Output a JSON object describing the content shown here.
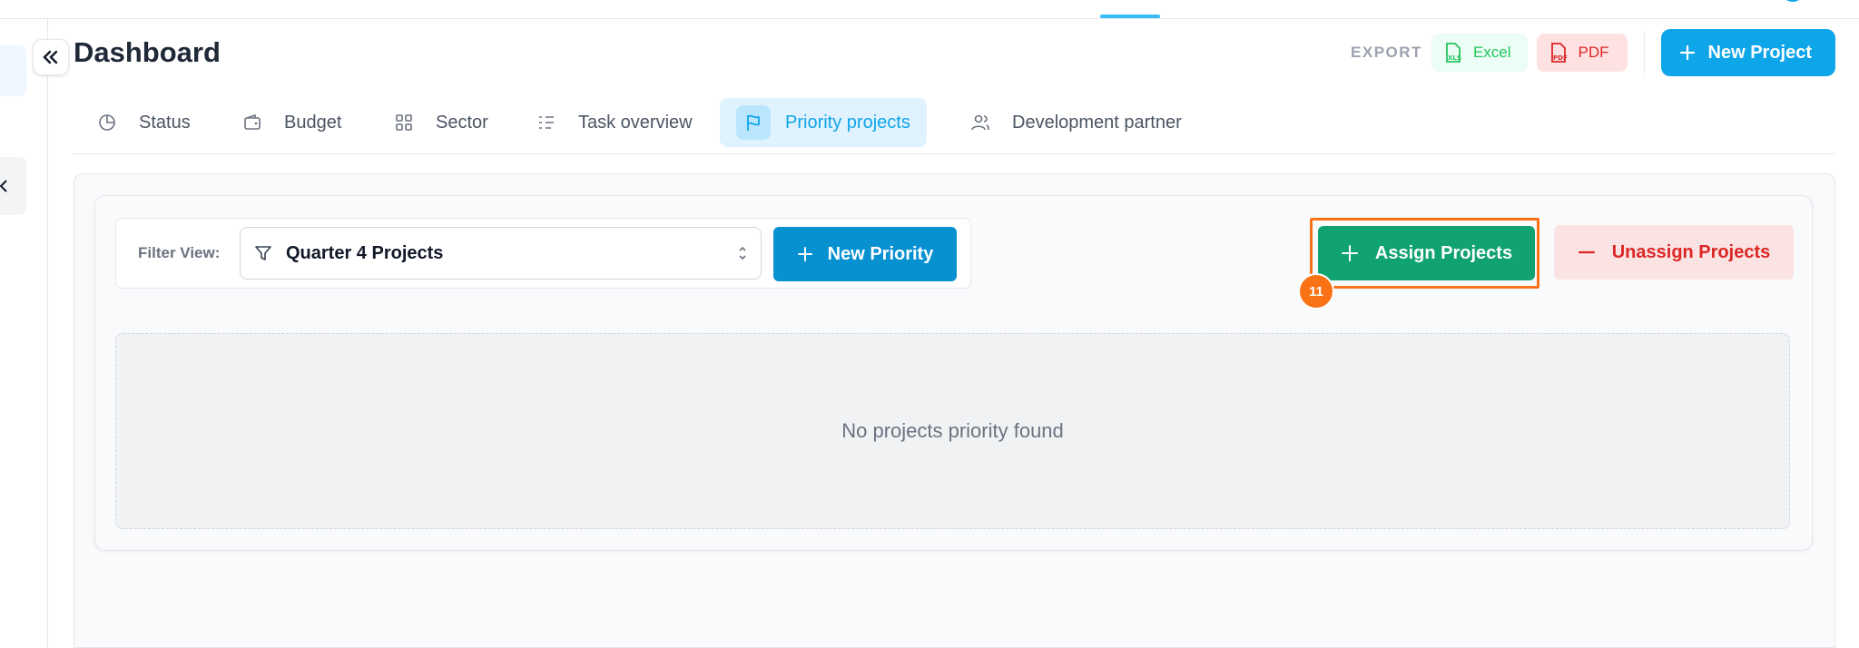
{
  "header": {
    "title": "Dashboard",
    "export_label": "EXPORT",
    "excel_label": "Excel",
    "pdf_label": "PDF",
    "new_project_label": "New Project"
  },
  "tabs": [
    {
      "label": "Status",
      "icon": "pie-chart-icon",
      "active": false
    },
    {
      "label": "Budget",
      "icon": "wallet-icon",
      "active": false
    },
    {
      "label": "Sector",
      "icon": "grid-icon",
      "active": false
    },
    {
      "label": "Task overview",
      "icon": "checklist-icon",
      "active": false
    },
    {
      "label": "Priority projects",
      "icon": "flag-icon",
      "active": true
    },
    {
      "label": "Development partner",
      "icon": "users-icon",
      "active": false
    }
  ],
  "filter": {
    "label": "Filter View:",
    "selected": "Quarter 4 Projects",
    "new_priority_label": "New Priority"
  },
  "actions": {
    "assign_label": "Assign Projects",
    "unassign_label": "Unassign Projects",
    "step_badge": "11"
  },
  "empty_state": {
    "message": "No projects priority found"
  },
  "colors": {
    "primary": "#0ea5e9",
    "success": "#10a36f",
    "danger": "#dc2626",
    "highlight": "#f97316"
  }
}
